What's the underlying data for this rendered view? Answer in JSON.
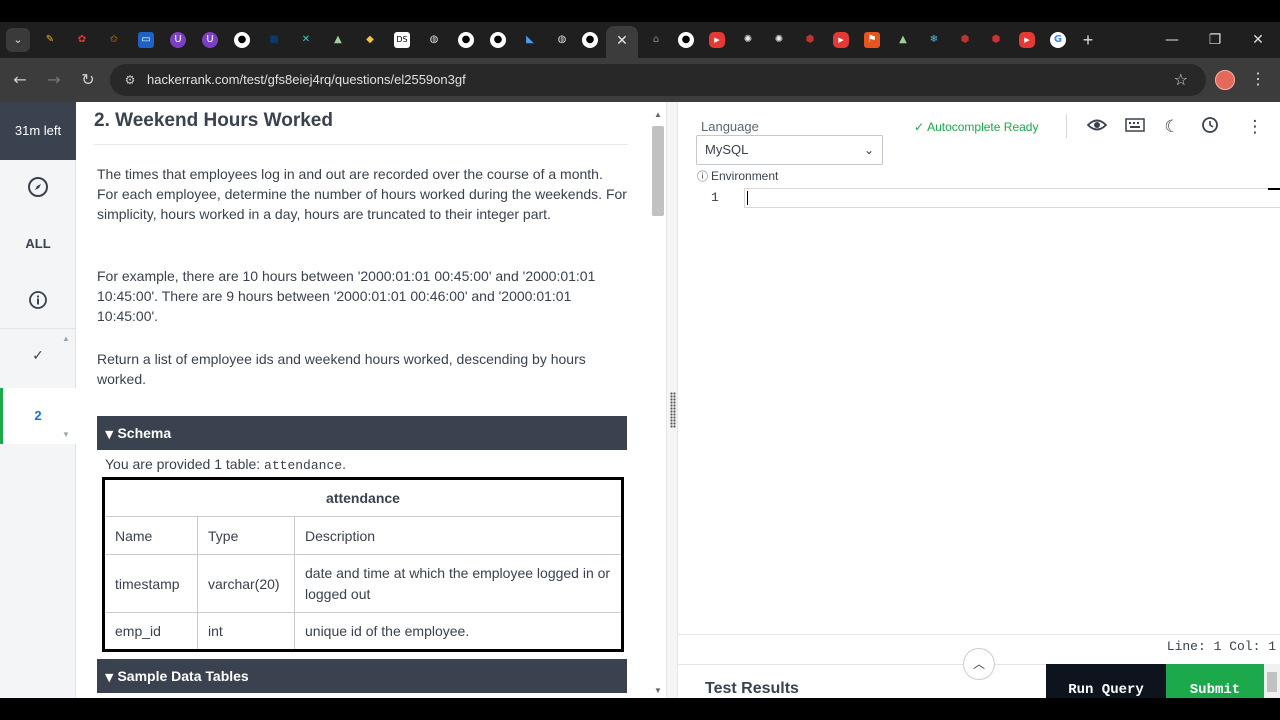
{
  "browser": {
    "tab_close_glyph": "✕",
    "new_tab_glyph": "+",
    "url": "hackerrank.com/test/gfs8eiej4rq/questions/el2559on3gf",
    "window_controls": {
      "minimize": "—",
      "restore": "❐",
      "close": "✕"
    },
    "nav": {
      "back": "←",
      "forward": "→",
      "reload": "↻",
      "tune": "⚙",
      "star": "☆",
      "menu": "⋮"
    }
  },
  "sidebar": {
    "time_left": "31m left",
    "all_label": "ALL",
    "check_glyph": "✓",
    "active_question": "2"
  },
  "problem": {
    "title": "2. Weekend Hours Worked",
    "paragraphs": [
      "The times that employees log in and out are recorded over the course of a month. For each employee, determine the number of hours worked during the weekends. For simplicity, hours worked in a day, hours are truncated to their integer part.",
      "For example, there are 10 hours between '2000:01:01 00:45:00' and '2000:01:01 10:45:00'. There are 9 hours between '2000:01:01 00:46:00' and '2000:01:01 10:45:00'.",
      "Return a list of employee ids and weekend hours worked, descending by hours worked."
    ],
    "schema_label": "Schema",
    "provided_prefix": "You are provided 1 table: ",
    "provided_table": "attendance",
    "provided_suffix": ".",
    "table": {
      "title": "attendance",
      "headers": [
        "Name",
        "Type",
        "Description"
      ],
      "rows": [
        [
          "timestamp",
          "varchar(20)",
          "date and time at which the employee logged in or logged out"
        ],
        [
          "emp_id",
          "int",
          "unique id of the employee."
        ]
      ]
    },
    "sample_label": "Sample Data Tables"
  },
  "editor": {
    "language_label": "Language",
    "language_value": "MySQL",
    "environment_label": "Environment",
    "autocomplete": "Autocomplete Ready",
    "line_number": "1",
    "status": "Line: 1 Col: 1",
    "test_results": "Test Results",
    "run_label": "Run Query",
    "submit_label": "Submit"
  },
  "colors": {
    "accent_green": "#1ba94c",
    "dark": "#39424e"
  }
}
